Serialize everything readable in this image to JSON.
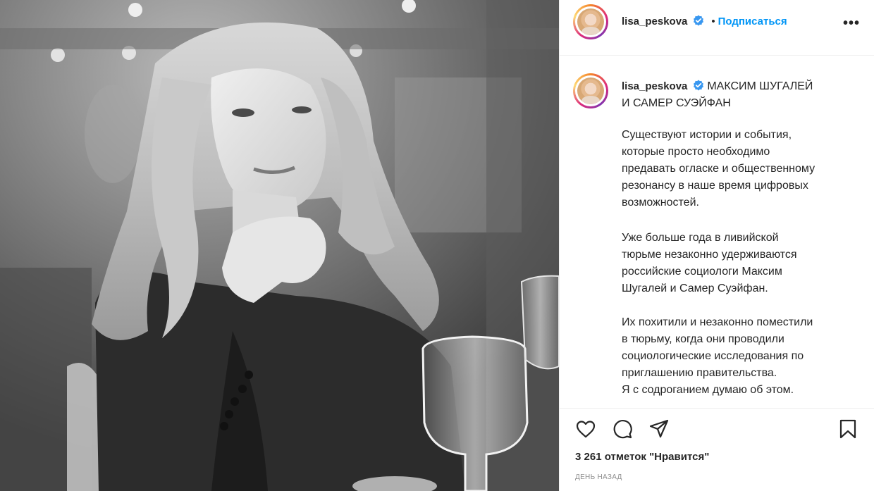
{
  "post": {
    "username": "lisa_peskova",
    "follow_label": "Подписаться",
    "dot": "•",
    "more_label": "•••"
  },
  "caption": {
    "username": "lisa_peskova",
    "title_line1": "МАКСИМ ШУГАЛЕЙ",
    "title_line2": "И САМЕР СУЭЙФАН",
    "p1_lines": [
      "Существуют истории и события,",
      "которые просто необходимо",
      "предавать огласке и общественному",
      "резонансу в наше время цифровых",
      "возможностей."
    ],
    "p2_lines": [
      "Уже больше года в ливийской",
      "тюрьме незаконно удерживаются",
      "российские социологи Максим",
      "Шугалей и Самер Суэйфан."
    ],
    "p3_lines": [
      "Их похитили и незаконно поместили",
      "в тюрьму, когда они проводили",
      "социологические исследования по",
      "приглашению правительства.",
      "Я с содроганием думаю об этом."
    ]
  },
  "actions": {
    "like_icon": "heart-icon",
    "comment_icon": "comment-icon",
    "share_icon": "share-icon",
    "save_icon": "bookmark-icon",
    "likes_text": "3 261 отметок \"Нравится\"",
    "time_ago": "ДЕНЬ НАЗАД"
  },
  "colors": {
    "link": "#0095f6",
    "verified": "#3897f0",
    "muted": "#8e8e8e",
    "border": "#efefef"
  }
}
